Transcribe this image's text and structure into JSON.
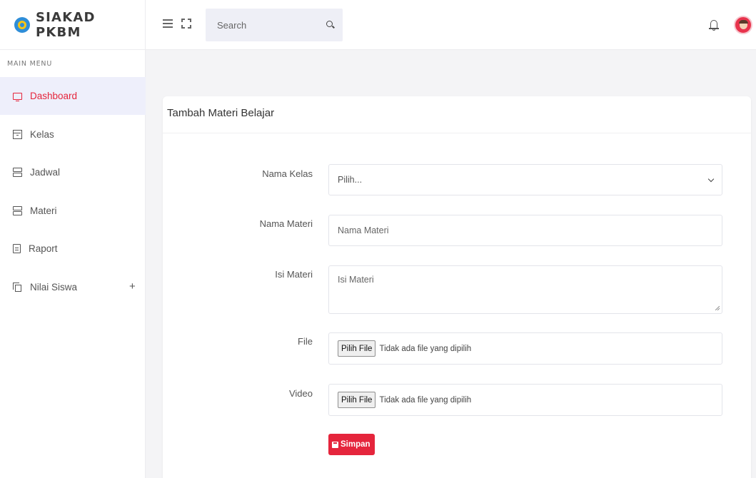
{
  "brand": {
    "name": "SIAKAD PKBM"
  },
  "header": {
    "search_placeholder": "Search",
    "icons": [
      "menu-icon",
      "fullscreen-icon",
      "search-icon",
      "bell-icon",
      "avatar"
    ]
  },
  "sidebar": {
    "caption": "MAIN MENU",
    "items": [
      {
        "label": "Dashboard",
        "icon": "monitor-icon",
        "active": true
      },
      {
        "label": "Kelas",
        "icon": "archive-icon"
      },
      {
        "label": "Jadwal",
        "icon": "server-icon"
      },
      {
        "label": "Materi",
        "icon": "server-icon"
      },
      {
        "label": "Raport",
        "icon": "file-text-icon"
      },
      {
        "label": "Nilai Siswa",
        "icon": "copy-icon",
        "expand": "+"
      }
    ]
  },
  "form": {
    "title": "Tambah Materi Belajar",
    "nama_kelas": {
      "label": "Nama Kelas",
      "selected": "Pilih..."
    },
    "nama_materi": {
      "label": "Nama Materi",
      "placeholder": "Nama Materi"
    },
    "isi_materi": {
      "label": "Isi Materi",
      "placeholder": "Isi Materi"
    },
    "file": {
      "label": "File",
      "button": "Pilih File",
      "status": "Tidak ada file yang dipilih"
    },
    "video": {
      "label": "Video",
      "button": "Pilih File",
      "status": "Tidak ada file yang dipilih"
    },
    "save_label": "Simpan"
  },
  "colors": {
    "accent": "#e5253c",
    "active_bg": "#eeeffb",
    "page_bg": "#f4f4f6"
  }
}
